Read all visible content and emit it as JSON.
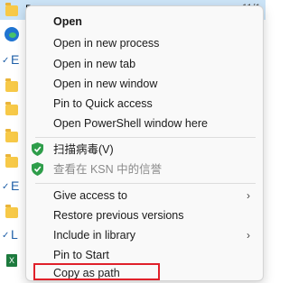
{
  "background": {
    "selected_row_label": "D",
    "selected_row_date": "11/1",
    "side_letters": [
      "E",
      "E",
      "L"
    ]
  },
  "menu": {
    "items": [
      {
        "label": "Open",
        "bold": true
      },
      {
        "label": "Open in new process"
      },
      {
        "label": "Open in new tab"
      },
      {
        "label": "Open in new window"
      },
      {
        "label": "Pin to Quick access"
      },
      {
        "label": "Open PowerShell window here"
      },
      {
        "label": "扫描病毒(V)",
        "icon": "kaspersky-shield-icon"
      },
      {
        "label": "查看在 KSN 中的信誉",
        "icon": "kaspersky-shield-icon",
        "disabled": true
      },
      {
        "label": "Give access to",
        "submenu": true
      },
      {
        "label": "Restore previous versions"
      },
      {
        "label": "Include in library",
        "submenu": true
      },
      {
        "label": "Pin to Start"
      },
      {
        "label": "Copy as path",
        "highlighted": true
      }
    ],
    "submenu_arrow": "›"
  },
  "colors": {
    "highlight_border": "#e0202a",
    "shield_green": "#2e9d4a"
  }
}
